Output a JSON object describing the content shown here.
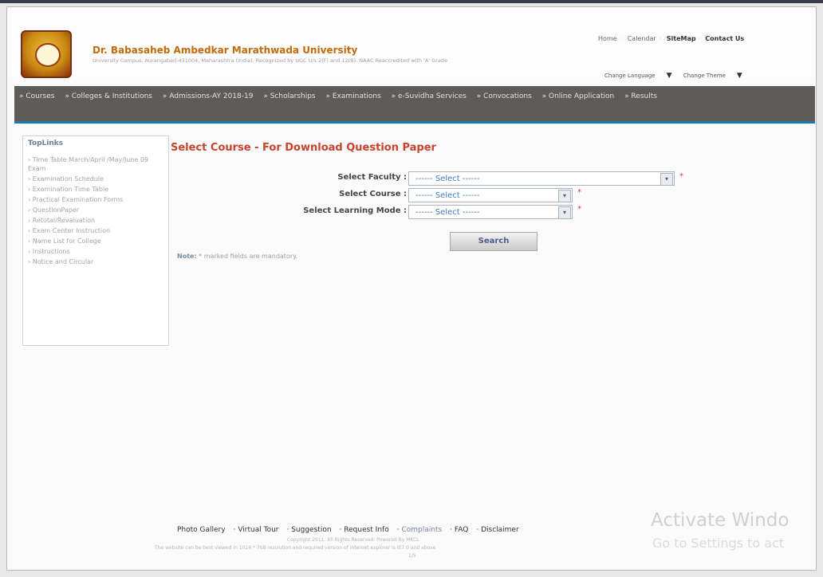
{
  "header": {
    "university_name": "Dr. Babasaheb Ambedkar Marathwada University",
    "university_sub": "University Campus, Aurangabad-431004, Maharashtra (India). Recognized by UGC U/s 2(F) and 12(B). NAAC Reaccredited with 'A' Grade",
    "top_links": [
      "Home",
      "Calendar",
      "SiteMap",
      "Contact Us"
    ],
    "change_language": "Change Language",
    "change_theme": "Change Theme"
  },
  "nav": {
    "items": [
      "» Courses",
      "» Colleges & Institutions",
      "» Admissions-AY 2018-19",
      "» Scholarships",
      "» Examinations",
      "» e-Suvidha Services",
      "» Convocations",
      "» Online Application",
      "» Results"
    ]
  },
  "sidebar": {
    "title": "TopLinks",
    "items": [
      "› Time Table March/April /May/June 09 Exam",
      "› Examination Schedule",
      "› Examination Time Table",
      "› Practical Examination Forms",
      "› QuestionPaper",
      "› Retotal/Revaluation",
      "› Exam Center Instruction",
      "› Name List for College",
      "› Instructions",
      "› Notice and Circular"
    ]
  },
  "main": {
    "title": "Select Course - For Download Question Paper",
    "faculty_label": "Select Faculty :",
    "course_label": "Select Course :",
    "mode_label": "Select Learning Mode :",
    "select_placeholder": "------ Select ------",
    "required_mark": "*",
    "search_button": "Search",
    "note_label": "Note:",
    "note_text": " * marked fields are mandatory."
  },
  "footer": {
    "links": [
      "Photo Gallery",
      "Virtual Tour",
      "Suggestion",
      "Request Info",
      "Complaints",
      "FAQ",
      "Disclaimer"
    ],
    "copyright": "Copyright 2011. All Rights Reserved. Powered By MKCL",
    "browser_note": "The website can be best viewed in 1024 * 768 resolution and required version of internet explorer is IE7.0 and above",
    "visits": "1/5"
  },
  "watermark": {
    "line1": "Activate Windo",
    "line2": "Go to Settings to act"
  }
}
